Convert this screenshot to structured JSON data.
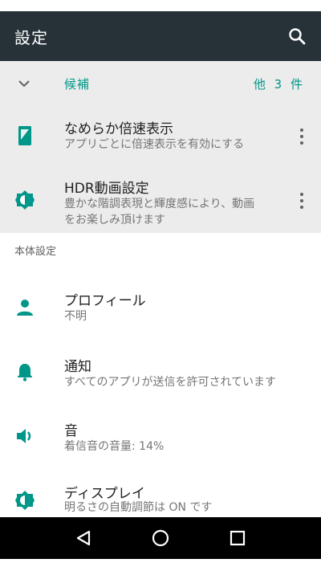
{
  "appbar": {
    "title": "設定",
    "search_icon": "search-icon"
  },
  "suggestions": {
    "title": "候補",
    "count_label": "他 3 件",
    "items": [
      {
        "title": "なめらか倍速表示",
        "subtitle": "アプリごとに倍速表示を有効にする",
        "icon": "phone-speed-icon"
      },
      {
        "title": "HDR動画設定",
        "subtitle_line1": "豊かな階調表現と輝度感により、動画",
        "subtitle_line2": "をお楽しみ頂けます",
        "icon": "brightness-icon"
      }
    ]
  },
  "section": {
    "label": "本体設定"
  },
  "settings": [
    {
      "title": "プロフィール",
      "subtitle": "不明",
      "icon": "person-icon"
    },
    {
      "title": "通知",
      "subtitle": "すべてのアプリが送信を許可されています",
      "icon": "bell-icon"
    },
    {
      "title": "音",
      "subtitle": "着信音の音量: 14%",
      "icon": "volume-icon"
    },
    {
      "title": "ディスプレイ",
      "subtitle": "明るさの自動調節は ON です",
      "icon": "brightness-icon"
    }
  ],
  "colors": {
    "appbar": "#263238",
    "accent": "#009688",
    "suggestion_bg": "#ececec"
  }
}
